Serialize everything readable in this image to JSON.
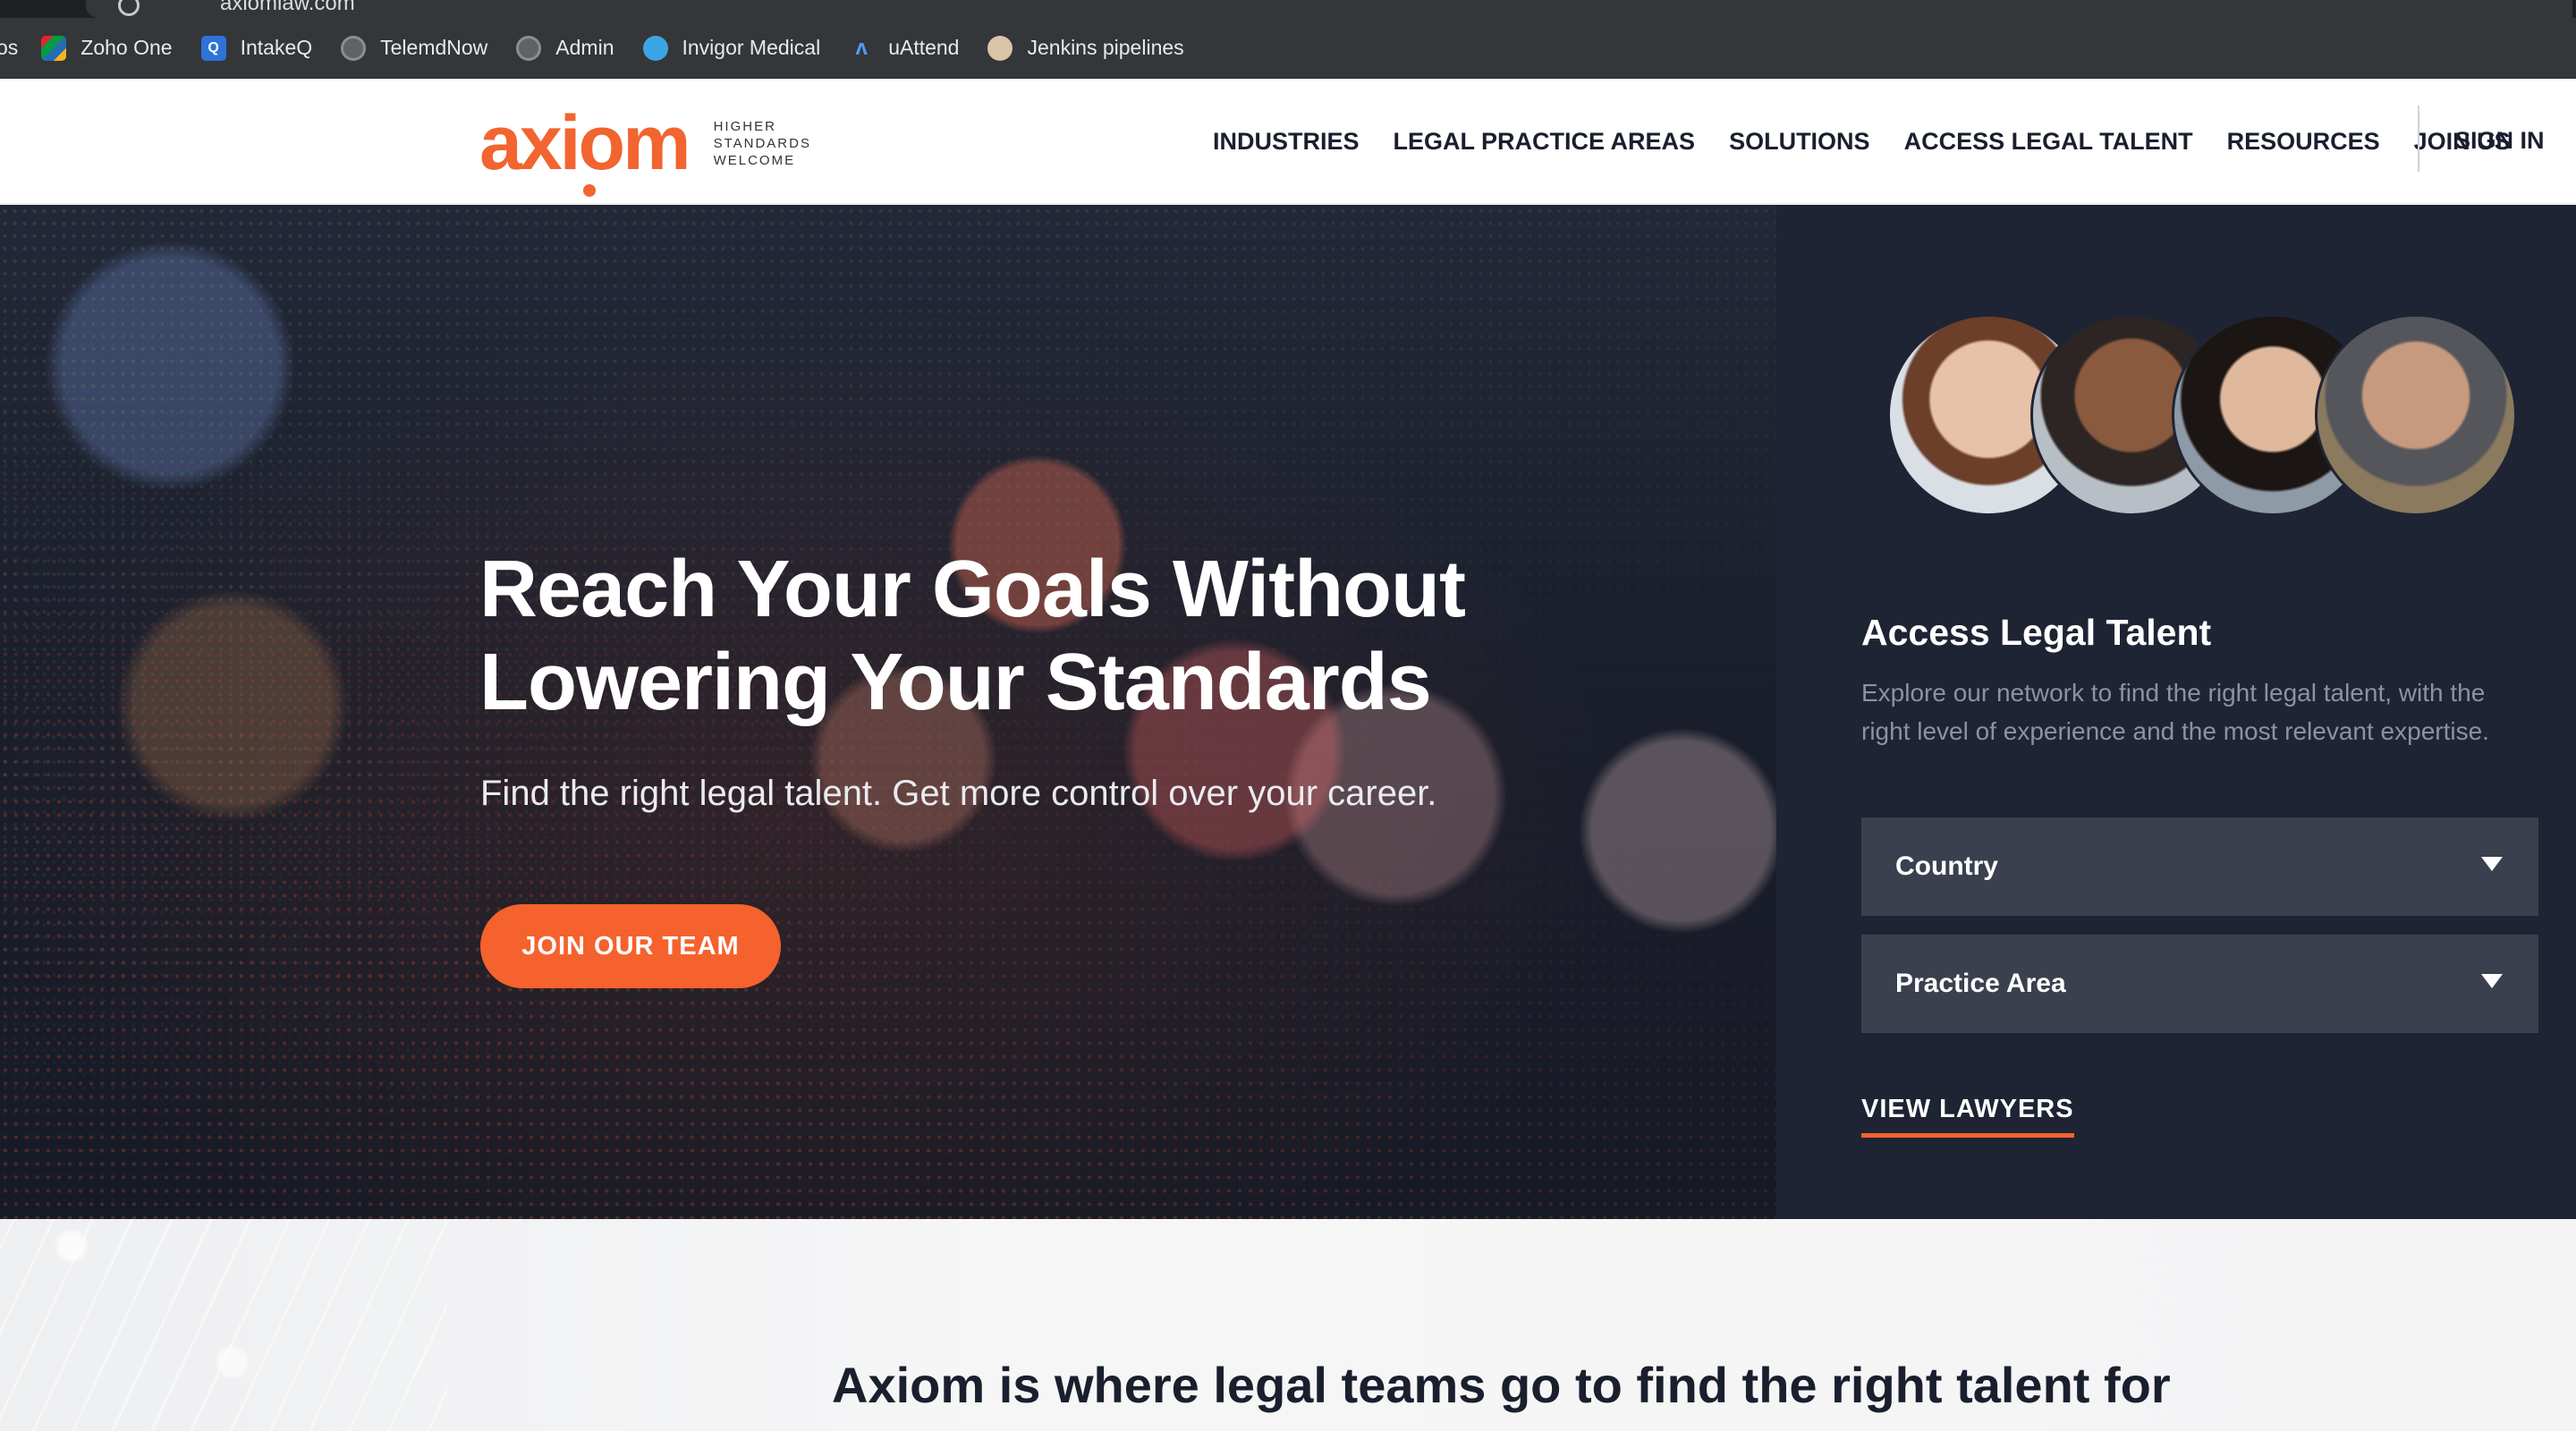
{
  "browser": {
    "tab_title": "axiomlaw.com",
    "bookmark_lead": "os",
    "bookmarks": [
      {
        "label": "Zoho One",
        "icon": "zoho-icon"
      },
      {
        "label": "IntakeQ",
        "icon": "intakeq-icon"
      },
      {
        "label": "TelemdNow",
        "icon": "globe-icon"
      },
      {
        "label": "Admin",
        "icon": "globe-icon"
      },
      {
        "label": "Invigor Medical",
        "icon": "invigor-icon"
      },
      {
        "label": "uAttend",
        "icon": "uattend-icon"
      },
      {
        "label": "Jenkins pipelines",
        "icon": "jenkins-icon"
      }
    ]
  },
  "header": {
    "logo_text": "axiom",
    "tagline": [
      "HIGHER",
      "STANDARDS",
      "WELCOME"
    ],
    "nav": [
      "INDUSTRIES",
      "LEGAL PRACTICE AREAS",
      "SOLUTIONS",
      "ACCESS LEGAL TALENT",
      "RESOURCES",
      "JOIN US"
    ],
    "sign_in": "SIGN IN"
  },
  "hero": {
    "title_line1": "Reach Your Goals Without",
    "title_line2": "Lowering Your Standards",
    "subtitle": "Find the right legal talent. Get more control over your career.",
    "cta": "JOIN OUR TEAM"
  },
  "panel": {
    "title": "Access Legal Talent",
    "description": "Explore our network to find the right legal talent, with the right level of experience and the most relevant expertise.",
    "country_select": "Country",
    "practice_select": "Practice Area",
    "view_link": "VIEW LAWYERS"
  },
  "lower": {
    "text": "Axiom is where legal teams go to find the right talent for"
  },
  "colors": {
    "brand_orange": "#f5622d",
    "navy": "#1e2433",
    "select_bg": "#3a404d"
  }
}
